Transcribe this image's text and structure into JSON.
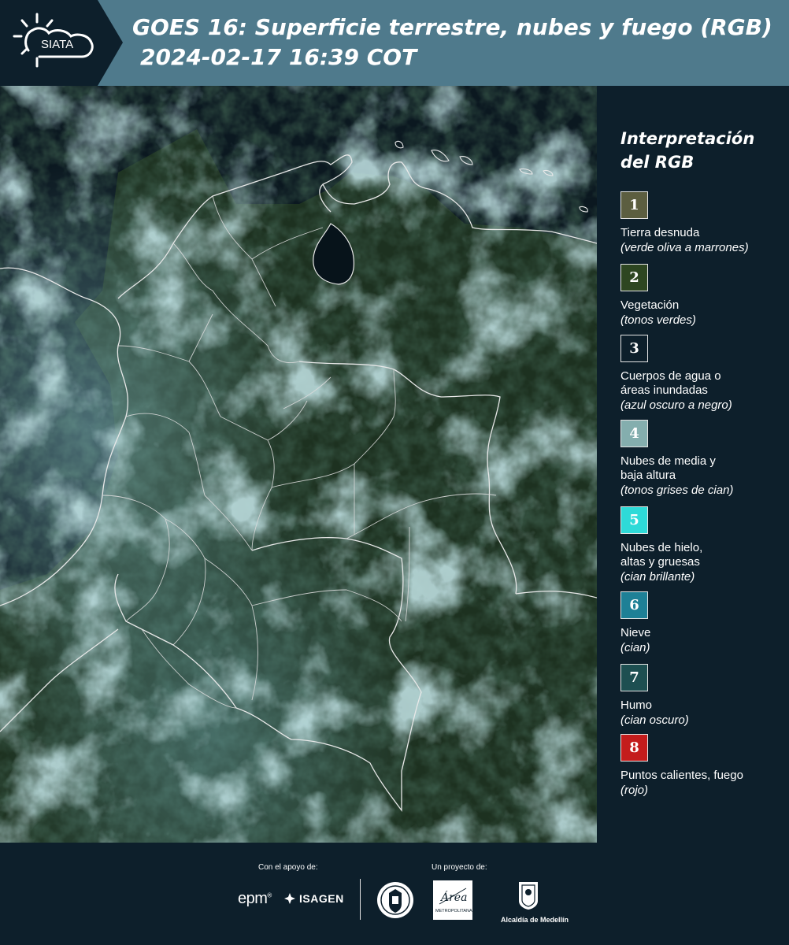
{
  "header": {
    "logo_text": "SIATA",
    "title": "GOES 16: Superficie terrestre, nubes y fuego (RGB)",
    "subtitle": "2024-02-17 16:39 COT",
    "background_color": "#4f7a8c"
  },
  "legend": {
    "title_line1": "Interpretación",
    "title_line2": "del RGB",
    "items": [
      {
        "number": "1",
        "color": "#5c5e40",
        "label_lines": [
          "Tierra desnuda"
        ],
        "hint": "(verde oliva a marrones)"
      },
      {
        "number": "2",
        "color": "#2d4621",
        "label_lines": [
          "Vegetación"
        ],
        "hint": "(tonos verdes)"
      },
      {
        "number": "3",
        "color": "#0d1f2b",
        "label_lines": [
          "Cuerpos de agua o",
          "áreas inundadas"
        ],
        "hint": "(azul oscuro a negro)"
      },
      {
        "number": "4",
        "color": "#84aeae",
        "label_lines": [
          "Nubes de media y",
          "baja altura"
        ],
        "hint": "(tonos grises de cian)"
      },
      {
        "number": "5",
        "color": "#2edad8",
        "label_lines": [
          "Nubes de hielo,",
          "altas y gruesas"
        ],
        "hint": "(cian brillante)"
      },
      {
        "number": "6",
        "color": "#1e8096",
        "label_lines": [
          "Nieve"
        ],
        "hint": "(cian)"
      },
      {
        "number": "7",
        "color": "#1d4f51",
        "label_lines": [
          "Humo"
        ],
        "hint": "(cian oscuro)"
      },
      {
        "number": "8",
        "color": "#c41c1c",
        "label_lines": [
          "Puntos calientes, fuego"
        ],
        "hint": "(rojo)"
      }
    ]
  },
  "footer": {
    "support_label": "Con el apoyo de:",
    "project_label": "Un proyecto de:",
    "sponsor_1": "epm",
    "sponsor_2": "ISAGEN",
    "area_logo_text": "Área",
    "area_logo_sub": "METROPOLITANA",
    "alcaldia_label": "Alcaldía de Medellín"
  },
  "map": {
    "region": "Colombia",
    "boundary_color": "#e8e8e8"
  }
}
